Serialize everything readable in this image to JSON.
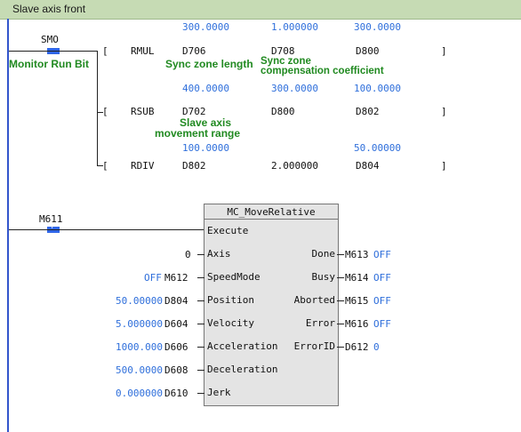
{
  "title": "Slave axis front",
  "rung1": {
    "contact_name": "SMO",
    "contact_annotation": "Monitor Run Bit",
    "row1": {
      "op": "RMUL",
      "a": "D706",
      "b": "D708",
      "c": "D800",
      "a_val_above": "300.0000",
      "b_val_above": "1.000000",
      "c_val_above": "300.0000",
      "a_val_below": "400.0000",
      "b_val_below": "300.0000",
      "c_val_below": "100.0000",
      "a_comment": "Sync zone length",
      "b_comment_1": "Sync zone",
      "b_comment_2": "compensation coefficient"
    },
    "row2": {
      "op": "RSUB",
      "a": "D702",
      "b": "D800",
      "c": "D802",
      "a_comment_1": "Slave axis",
      "a_comment_2": "movement range",
      "a_val_below": "100.0000",
      "c_val_below": "50.00000"
    },
    "row3": {
      "op": "RDIV",
      "a": "D802",
      "b": "2.000000",
      "c": "D804"
    },
    "bracket_open": "[",
    "bracket_close": "]"
  },
  "rung2": {
    "contact_name": "M611",
    "block": {
      "name": "MC_MoveRelative",
      "inputs": [
        {
          "pin": "Execute",
          "value": "",
          "var": ""
        },
        {
          "pin": "Axis",
          "value": "0",
          "var": ""
        },
        {
          "pin": "SpeedMode",
          "value": "OFF",
          "var": "M612"
        },
        {
          "pin": "Position",
          "value": "50.00000",
          "var": "D804"
        },
        {
          "pin": "Velocity",
          "value": "5.000000",
          "var": "D604"
        },
        {
          "pin": "Acceleration",
          "value": "1000.000",
          "var": "D606"
        },
        {
          "pin": "Deceleration",
          "value": "500.0000",
          "var": "D608"
        },
        {
          "pin": "Jerk",
          "value": "0.000000",
          "var": "D610"
        }
      ],
      "outputs": [
        {
          "pin": "Done",
          "var": "M613",
          "value": "OFF"
        },
        {
          "pin": "Busy",
          "var": "M614",
          "value": "OFF"
        },
        {
          "pin": "Aborted",
          "var": "M615",
          "value": "OFF"
        },
        {
          "pin": "Error",
          "var": "M616",
          "value": "OFF"
        },
        {
          "pin": "ErrorID",
          "var": "D612",
          "value": "0"
        }
      ]
    }
  },
  "colors": {
    "title_bg": "#c6dbb4",
    "value_blue": "#2f6fdb",
    "comment_green": "#218a21",
    "rail_blue": "#3355cc",
    "block_bg": "#e4e4e4"
  }
}
